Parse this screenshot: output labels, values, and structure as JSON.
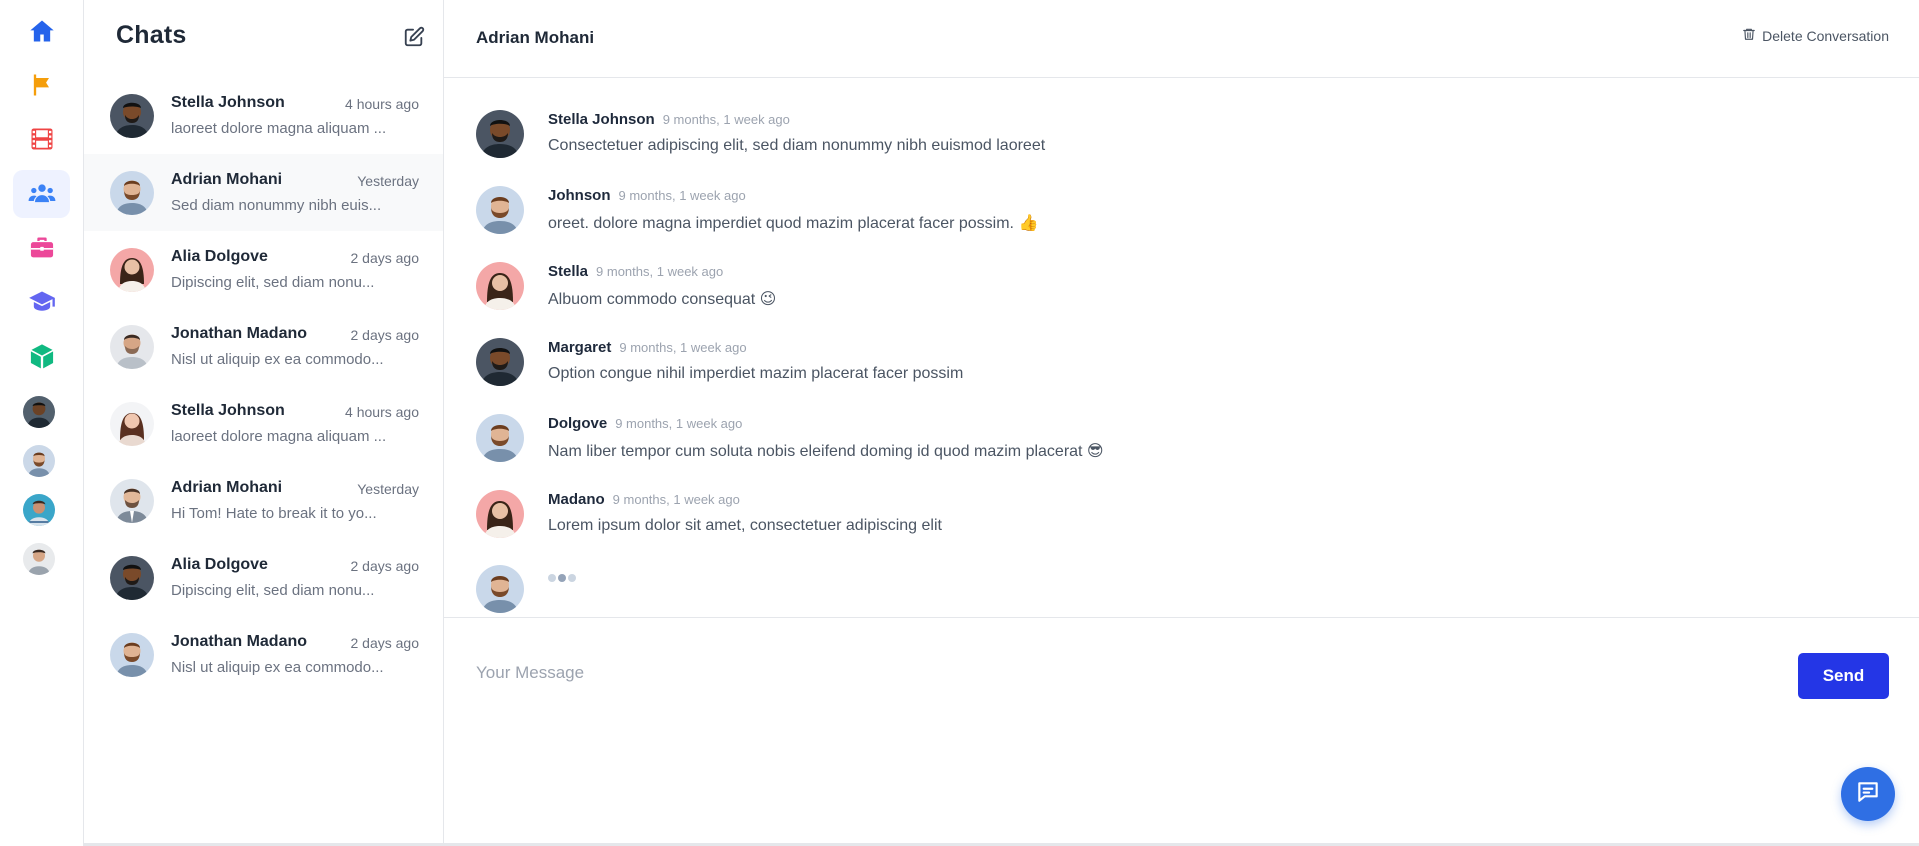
{
  "sidebar": {
    "nav": [
      {
        "name": "home-icon",
        "color": "#2563eb"
      },
      {
        "name": "flag-icon",
        "color": "#f59e0b"
      },
      {
        "name": "film-icon",
        "color": "#ef4444"
      },
      {
        "name": "users-icon",
        "color": "#3b82f6",
        "active": true
      },
      {
        "name": "briefcase-icon",
        "color": "#ec4899"
      },
      {
        "name": "graduation-cap-icon",
        "color": "#6366f1"
      },
      {
        "name": "cube-icon",
        "color": "#10b981"
      }
    ],
    "avatars": [
      "avatar-1",
      "avatar-2",
      "avatar-3",
      "avatar-4"
    ]
  },
  "chat_list": {
    "title": "Chats",
    "compose_icon": "edit-icon",
    "items": [
      {
        "name": "Stella Johnson",
        "time": "4 hours ago",
        "preview": "laoreet dolore magna aliquam ..."
      },
      {
        "name": "Adrian Mohani",
        "time": "Yesterday",
        "preview": "Sed diam nonummy nibh euis..."
      },
      {
        "name": "Alia Dolgove",
        "time": "2 days ago",
        "preview": "Dipiscing elit, sed diam nonu..."
      },
      {
        "name": "Jonathan Madano",
        "time": "2 days ago",
        "preview": "Nisl ut aliquip ex ea commodo..."
      },
      {
        "name": "Stella Johnson",
        "time": "4 hours ago",
        "preview": "laoreet dolore magna aliquam ..."
      },
      {
        "name": "Adrian Mohani",
        "time": "Yesterday",
        "preview": "Hi Tom! Hate to break it to yo..."
      },
      {
        "name": "Alia Dolgove",
        "time": "2 days ago",
        "preview": "Dipiscing elit, sed diam nonu..."
      },
      {
        "name": "Jonathan Madano",
        "time": "2 days ago",
        "preview": "Nisl ut aliquip ex ea commodo..."
      }
    ]
  },
  "conversation": {
    "title": "Adrian Mohani",
    "delete_label": "Delete Conversation",
    "messages": [
      {
        "name": "Stella Johnson",
        "time": "9 months, 1 week ago",
        "text": "Consectetuer adipiscing elit, sed diam nonummy nibh euismod laoreet"
      },
      {
        "name": "Johnson",
        "time": "9 months, 1 week ago",
        "text": "oreet. dolore magna imperdiet quod mazim placerat facer possim. 👍"
      },
      {
        "name": "Stella",
        "time": "9 months, 1 week ago",
        "text": "Albuom commodo consequat 😉"
      },
      {
        "name": "Margaret",
        "time": "9 months, 1 week ago",
        "text": "Option congue nihil imperdiet mazim placerat facer possim"
      },
      {
        "name": "Dolgove",
        "time": "9 months, 1 week ago",
        "text": "Nam liber tempor cum soluta nobis eleifend doming id quod mazim placerat 😎"
      },
      {
        "name": "Madano",
        "time": "9 months, 1 week ago",
        "text": "Lorem ipsum dolor sit amet, consectetuer adipiscing elit"
      }
    ],
    "input_placeholder": "Your Message",
    "send_label": "Send"
  },
  "colors": {
    "accent": "#2436e6",
    "fab": "#2f6fe4"
  }
}
